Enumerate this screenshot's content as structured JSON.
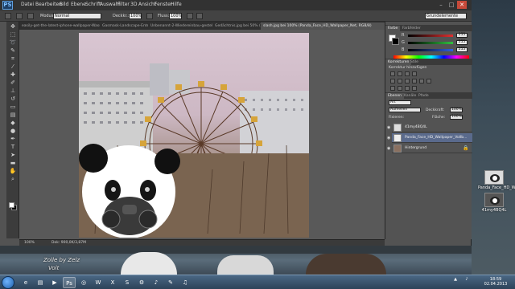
{
  "photoshop": {
    "logo": "PS",
    "menu": [
      "Datei",
      "Bearbeiten",
      "Bild",
      "Ebene",
      "Schrift",
      "Auswahl",
      "Filter",
      "3D",
      "Ansicht",
      "Fenster",
      "Hilfe"
    ],
    "workspace": "Grundelemente",
    "options": {
      "modus_label": "Modus:",
      "modus_value": "Normal",
      "deckkraft_label": "Deckkr.:",
      "deckkraft_value": "100%",
      "fluss_label": "Fluss:",
      "fluss_value": "100%"
    },
    "tabs": [
      "easily-get-the-latest-iphone-wallpaper-Wasserlinie.jpg",
      "Gasmask-Landscape-Entertainment.jpg",
      "Unbenannt-2-Wiedereinbau-gestellt-Bild.jpg bei 50% (Ebene 1, RGB/8)",
      "Gedächtnis.jpg bei 50% (Ebene 1, RGB/8)",
      "slash.jpg bei 100% (Panda_Face_HD_Wallpaper_Net, RGB/8)"
    ],
    "status": {
      "zoom": "100%",
      "doc": "Dok: 900,0K/3,87M"
    }
  },
  "panels": {
    "color_tabs": [
      "Farbe",
      "Farbfelder"
    ],
    "channels": [
      {
        "label": "R",
        "value": "255",
        "color": "#e03030"
      },
      {
        "label": "G",
        "value": "255",
        "color": "#30c040"
      },
      {
        "label": "B",
        "value": "255",
        "color": "#3060e0"
      }
    ],
    "adjust_tabs": [
      "Korrekturen",
      "Stile"
    ],
    "adjust_title": "Korrektur hinzufügen",
    "layers_tabs": [
      "Ebenen",
      "Kanäle",
      "Pfade"
    ],
    "layers_kind": "Art",
    "layers_blend": "Aufhellen",
    "layers_opacity_label": "Deckkraft:",
    "layers_opacity_value": "100%",
    "layers_lock_label": "Fixieren:",
    "layers_fill_label": "Fläche:",
    "layers_fill_value": "100%",
    "layers": [
      {
        "name": "41my4BQ4L",
        "selected": false
      },
      {
        "name": "Panda_Face_HD_Wallpaper_Vollb...",
        "selected": true
      },
      {
        "name": "Hintergrund",
        "selected": false
      }
    ]
  },
  "minibridge": {
    "text1": "Zolle by Zelz",
    "text2": "Volt"
  },
  "desktop": {
    "icons": [
      {
        "label": "Panda_Face_HD_W..."
      },
      {
        "label": "41my4BQ4L"
      }
    ]
  },
  "taskbar": {
    "time": "18:59",
    "date": "02.04.2013",
    "apps": [
      "ie",
      "folder",
      "media",
      "ps",
      "chrome",
      "word",
      "excel",
      "skype",
      "steam",
      "player",
      "paint",
      "music"
    ]
  }
}
